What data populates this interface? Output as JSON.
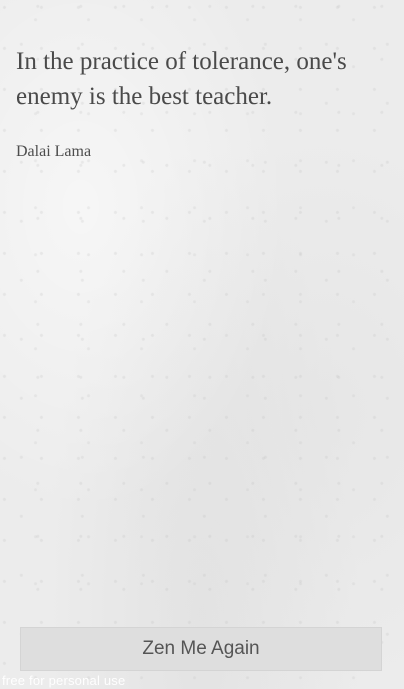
{
  "quote": {
    "text": "In the practice of tolerance, one's enemy is the best teacher.",
    "author": "Dalai Lama"
  },
  "actions": {
    "zen_button_label": "Zen Me Again"
  },
  "footer": {
    "credit": "free for personal use"
  },
  "colors": {
    "background": "#ececec",
    "text": "#4a4a4a",
    "button_bg": "#dedede",
    "button_text": "#555555"
  }
}
